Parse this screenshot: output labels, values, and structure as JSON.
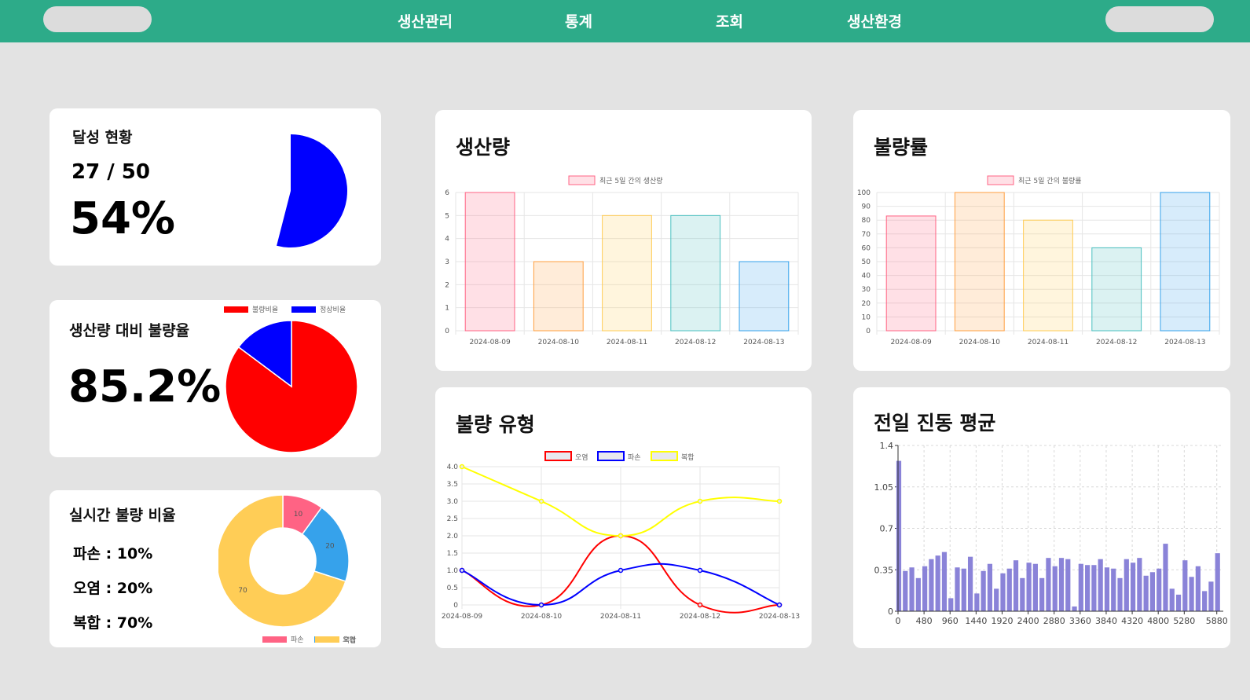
{
  "nav": {
    "items": [
      "생산관리",
      "통계",
      "조회",
      "생산환경"
    ]
  },
  "achievement": {
    "title": "달성 현황",
    "count": "27 / 50",
    "percent": "54%",
    "ratio": 0.54,
    "color": "#0000ff"
  },
  "defect_rate_vs_production": {
    "title": "생산량 대비 불량율",
    "percent": "85.2%",
    "legend": [
      "불량비율",
      "정상비율"
    ],
    "colors": [
      "#ff0000",
      "#0000ff"
    ]
  },
  "realtime_defect": {
    "title": "실시간 불량 비율",
    "lines": [
      "파손 : 10%",
      "오염 : 20%",
      "복합 : 70%"
    ],
    "legend": [
      "파손",
      "오염",
      "복합"
    ],
    "colors": [
      "#ff6384",
      "#36a2eb",
      "#ffcd56"
    ]
  },
  "production": {
    "title": "생산량",
    "legend": "최근 5일 간의 생산량"
  },
  "defect_ratio": {
    "title": "불량률",
    "legend": "최근 5일 간의 불량률"
  },
  "defect_type": {
    "title": "불량 유형",
    "legend": [
      "오염",
      "파손",
      "복합"
    ]
  },
  "vibration": {
    "title": "전일 진동 평균"
  },
  "chart_data": [
    {
      "type": "pie",
      "categories": [
        "달성"
      ],
      "values": [
        54
      ]
    },
    {
      "type": "pie",
      "categories": [
        "불량비율",
        "정상비율"
      ],
      "values": [
        85.2,
        14.8
      ]
    },
    {
      "type": "pie",
      "categories": [
        "파손",
        "오염",
        "복합"
      ],
      "values": [
        10,
        20,
        70
      ],
      "data_labels": [
        "10",
        "20",
        "70"
      ]
    },
    {
      "type": "bar",
      "categories": [
        "2024-08-09",
        "2024-08-10",
        "2024-08-11",
        "2024-08-12",
        "2024-08-13"
      ],
      "values": [
        6,
        3,
        5,
        5,
        3
      ],
      "ylim": [
        0,
        6
      ],
      "yticks": [
        "0",
        "1",
        "2",
        "3",
        "4",
        "5",
        "6"
      ],
      "colors": [
        "#ff6384",
        "#ff9f40",
        "#ffcd56",
        "#4bc0c0",
        "#36a2eb"
      ]
    },
    {
      "type": "bar",
      "categories": [
        "2024-08-09",
        "2024-08-10",
        "2024-08-11",
        "2024-08-12",
        "2024-08-13"
      ],
      "values": [
        83,
        100,
        80,
        60,
        100
      ],
      "ylim": [
        0,
        100
      ],
      "yticks": [
        "0",
        "10",
        "20",
        "30",
        "40",
        "50",
        "60",
        "70",
        "80",
        "90",
        "100"
      ],
      "colors": [
        "#ff6384",
        "#ff9f40",
        "#ffcd56",
        "#4bc0c0",
        "#36a2eb"
      ]
    },
    {
      "type": "line",
      "categories": [
        "2024-08-09",
        "2024-08-10",
        "2024-08-11",
        "2024-08-12",
        "2024-08-13"
      ],
      "series": [
        {
          "name": "오염",
          "values": [
            1,
            0,
            2,
            0,
            0
          ],
          "color": "#ff0000"
        },
        {
          "name": "파손",
          "values": [
            1,
            0,
            1,
            1,
            0
          ],
          "color": "#0000ff"
        },
        {
          "name": "복합",
          "values": [
            4,
            3,
            2,
            3,
            3
          ],
          "color": "#ffff00"
        }
      ],
      "ylim": [
        0,
        4
      ],
      "yticks": [
        "0",
        "0.5",
        "1.0",
        "1.5",
        "2.0",
        "2.5",
        "3.0",
        "3.5",
        "4.0"
      ]
    },
    {
      "type": "bar",
      "xticks": [
        "0",
        "480",
        "960",
        "1440",
        "1920",
        "2400",
        "2880",
        "3360",
        "3840",
        "4320",
        "4800",
        "5280",
        "5880"
      ],
      "yticks": [
        "0",
        "0.35",
        "0.7",
        "1.05",
        "1.4"
      ],
      "ylim": [
        0,
        1.4
      ],
      "xlim": [
        0,
        6000
      ],
      "bar_width_units": 90,
      "color": "#8a83d8",
      "points": [
        [
          0,
          1.27
        ],
        [
          120,
          0.34
        ],
        [
          240,
          0.37
        ],
        [
          360,
          0.28
        ],
        [
          480,
          0.38
        ],
        [
          600,
          0.44
        ],
        [
          720,
          0.47
        ],
        [
          840,
          0.5
        ],
        [
          960,
          0.11
        ],
        [
          1080,
          0.37
        ],
        [
          1200,
          0.36
        ],
        [
          1320,
          0.46
        ],
        [
          1440,
          0.15
        ],
        [
          1560,
          0.34
        ],
        [
          1680,
          0.4
        ],
        [
          1800,
          0.19
        ],
        [
          1920,
          0.32
        ],
        [
          2040,
          0.36
        ],
        [
          2160,
          0.43
        ],
        [
          2280,
          0.28
        ],
        [
          2400,
          0.41
        ],
        [
          2520,
          0.4
        ],
        [
          2640,
          0.28
        ],
        [
          2760,
          0.45
        ],
        [
          2880,
          0.38
        ],
        [
          3000,
          0.45
        ],
        [
          3120,
          0.44
        ],
        [
          3240,
          0.04
        ],
        [
          3360,
          0.4
        ],
        [
          3480,
          0.39
        ],
        [
          3600,
          0.39
        ],
        [
          3720,
          0.44
        ],
        [
          3840,
          0.37
        ],
        [
          3960,
          0.36
        ],
        [
          4080,
          0.28
        ],
        [
          4200,
          0.44
        ],
        [
          4320,
          0.41
        ],
        [
          4440,
          0.45
        ],
        [
          4560,
          0.3
        ],
        [
          4680,
          0.33
        ],
        [
          4800,
          0.36
        ],
        [
          4920,
          0.57
        ],
        [
          5040,
          0.19
        ],
        [
          5160,
          0.14
        ],
        [
          5280,
          0.43
        ],
        [
          5400,
          0.29
        ],
        [
          5520,
          0.38
        ],
        [
          5640,
          0.17
        ],
        [
          5760,
          0.25
        ],
        [
          5880,
          0.49
        ]
      ]
    }
  ]
}
